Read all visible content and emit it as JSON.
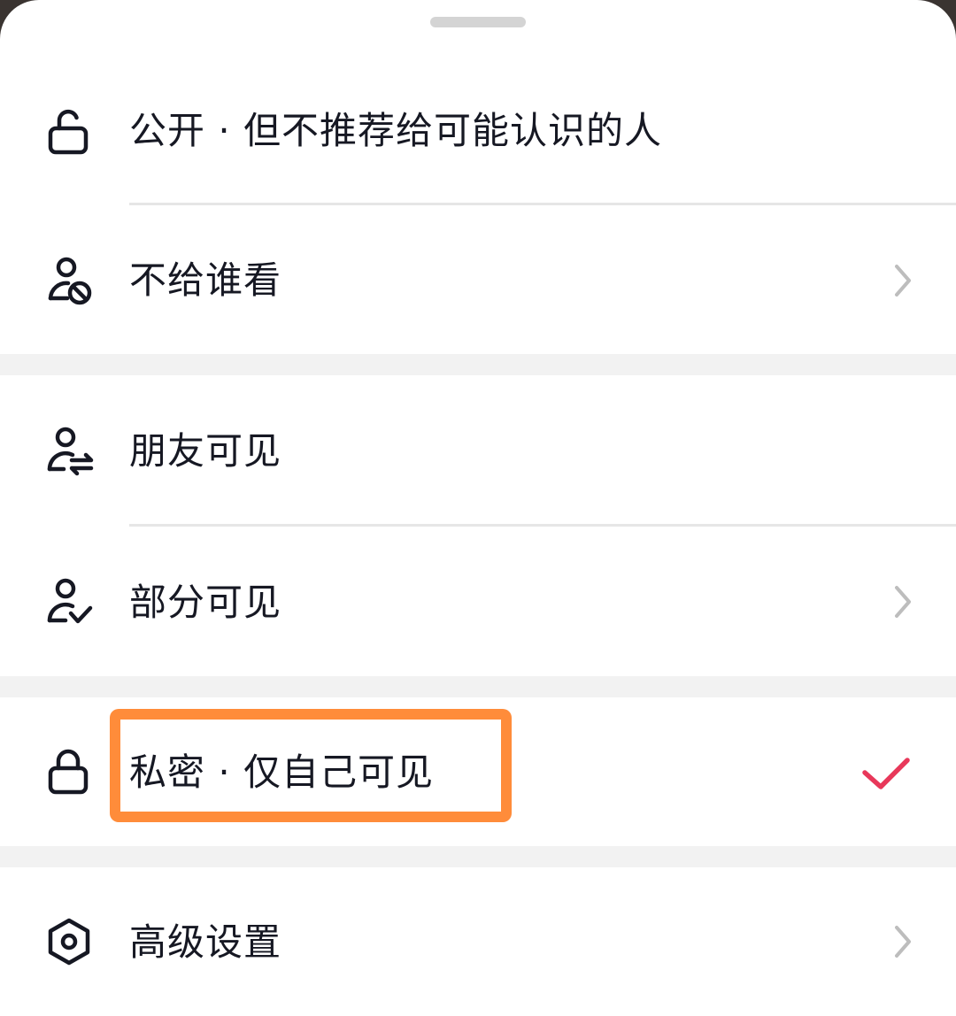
{
  "sheet": {
    "options": [
      {
        "label": "公开 · 但不推荐给可能认识的人",
        "icon": "unlock-icon",
        "has_chevron": false,
        "selected": false
      },
      {
        "label": "不给谁看",
        "icon": "user-block-icon",
        "has_chevron": true,
        "selected": false
      },
      {
        "label": "朋友可见",
        "icon": "user-friends-icon",
        "has_chevron": false,
        "selected": false
      },
      {
        "label": "部分可见",
        "icon": "user-check-icon",
        "has_chevron": true,
        "selected": false
      },
      {
        "label": "私密 · 仅自己可见",
        "icon": "lock-icon",
        "has_chevron": false,
        "selected": true
      },
      {
        "label": "高级设置",
        "icon": "settings-hexagon-icon",
        "has_chevron": true,
        "selected": false
      }
    ]
  },
  "colors": {
    "text": "#161823",
    "check": "#e8385a",
    "highlight": "#ff8c3a",
    "separator": "#f2f2f2"
  }
}
